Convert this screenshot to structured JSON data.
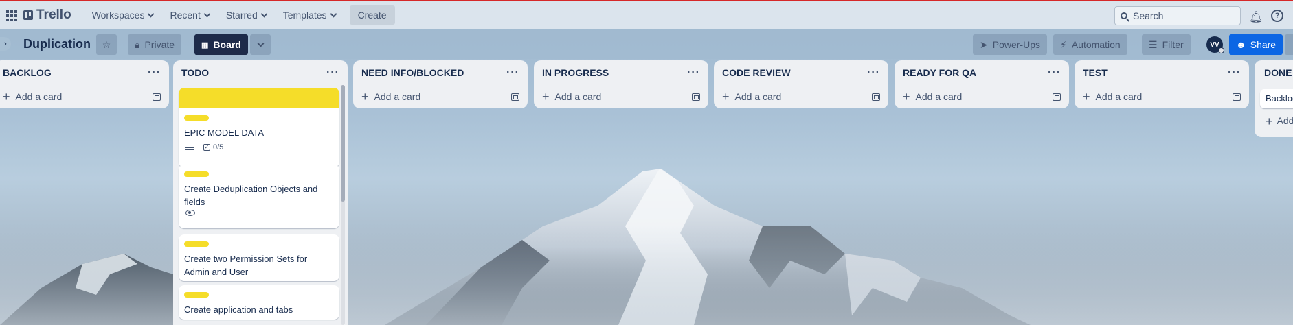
{
  "topnav": {
    "logo": "Trello",
    "menus": [
      "Workspaces",
      "Recent",
      "Starred",
      "Templates"
    ],
    "create": "Create",
    "search_placeholder": "Search",
    "help": "?"
  },
  "board": {
    "title": "Duplication",
    "visibility": "Private",
    "view": "Board",
    "powerups": "Power-Ups",
    "automation": "Automation",
    "filter": "Filter",
    "share": "Share",
    "avatar": "VV"
  },
  "add_card": "Add a card",
  "lists": {
    "backlog": "BACKLOG",
    "todo": "TODO",
    "need_info": "NEED INFO/BLOCKED",
    "in_progress": "IN PROGRESS",
    "code_review": "CODE REVIEW",
    "ready_qa": "READY FOR QA",
    "test": "TEST",
    "done": "DONE"
  },
  "todo_cards": [
    {
      "title": "EPIC MODEL DATA",
      "checklist": "0/5"
    },
    {
      "title": "Create Deduplication Objects and fields"
    },
    {
      "title": "Create two Permission Sets for Admin and User"
    },
    {
      "title": "Create application and tabs"
    }
  ],
  "done_card": "Backlog",
  "colors": {
    "label_yellow": "#f5dd29",
    "cover_yellow": "#f5dd29",
    "share_blue": "#0c66e4",
    "top_border": "#d62828"
  }
}
